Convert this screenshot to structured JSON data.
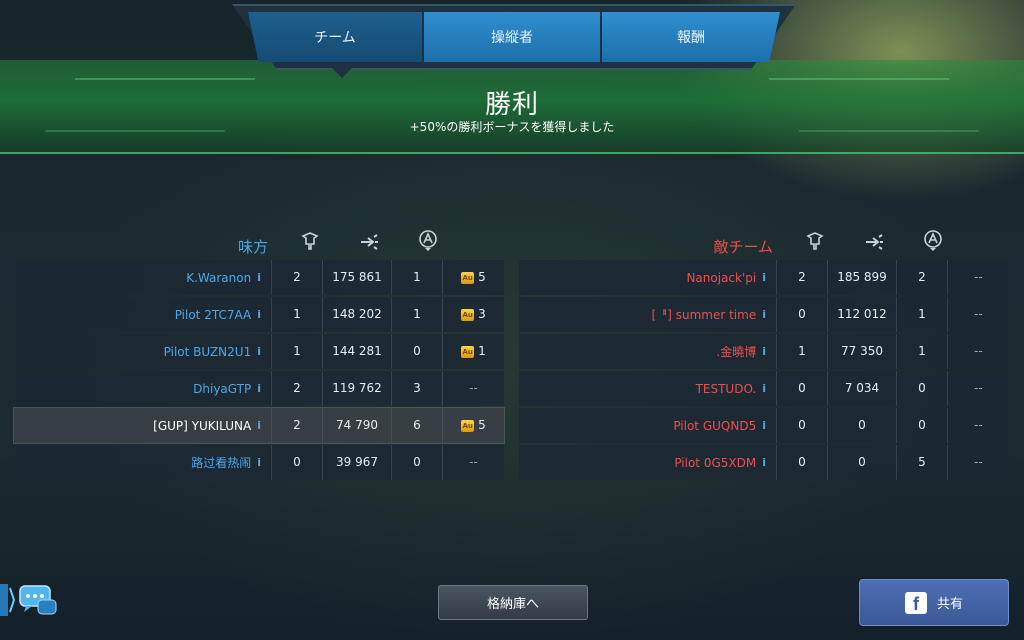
{
  "tabs": [
    {
      "label": "チーム"
    },
    {
      "label": "操縦者"
    },
    {
      "label": "報酬"
    }
  ],
  "result": {
    "title": "勝利",
    "subtitle": "+50%の勝利ボーナスを獲得しました"
  },
  "ally": {
    "name": "味方",
    "rows": [
      {
        "name": "K.Waranon",
        "kills": "2",
        "damage": "175 861",
        "assists": "1",
        "reward": "5"
      },
      {
        "name": "Pilot 2TC7AA",
        "kills": "1",
        "damage": "148 202",
        "assists": "1",
        "reward": "3"
      },
      {
        "name": "Pilot BUZN2U1",
        "kills": "1",
        "damage": "144 281",
        "assists": "0",
        "reward": "1"
      },
      {
        "name": "DhiyaGTP",
        "kills": "2",
        "damage": "119 762",
        "assists": "3",
        "reward": "--"
      },
      {
        "name": "[GUP] YUKILUNA",
        "kills": "2",
        "damage": "74 790",
        "assists": "6",
        "reward": "5"
      },
      {
        "name": "路过看热闹",
        "kills": "0",
        "damage": "39 967",
        "assists": "0",
        "reward": "--"
      }
    ]
  },
  "enemy": {
    "name": "敵チーム",
    "rows": [
      {
        "name": "Nanojack'pi",
        "kills": "2",
        "damage": "185 899",
        "assists": "2",
        "reward": "--"
      },
      {
        "name": "[ᅤ] summer time",
        "kills": "0",
        "damage": "112 012",
        "assists": "1",
        "reward": "--"
      },
      {
        "name": ".金曉博",
        "kills": "1",
        "damage": "77 350",
        "assists": "1",
        "reward": "--"
      },
      {
        "name": "TESTUDO.",
        "kills": "0",
        "damage": "7 034",
        "assists": "0",
        "reward": "--"
      },
      {
        "name": "Pilot GUQND5",
        "kills": "0",
        "damage": "0",
        "assists": "0",
        "reward": "--"
      },
      {
        "name": "Pilot 0G5XDM",
        "kills": "0",
        "damage": "0",
        "assists": "5",
        "reward": "--"
      }
    ]
  },
  "info_glyph": "i",
  "gold_glyph": "Au",
  "buttons": {
    "hangar": "格納庫へ",
    "share": "共有",
    "facebook": "f"
  },
  "icons": [
    "kills-icon",
    "damage-icon",
    "assist-icon",
    "chat-icon",
    "facebook-icon",
    "info-icon",
    "gold-icon"
  ]
}
